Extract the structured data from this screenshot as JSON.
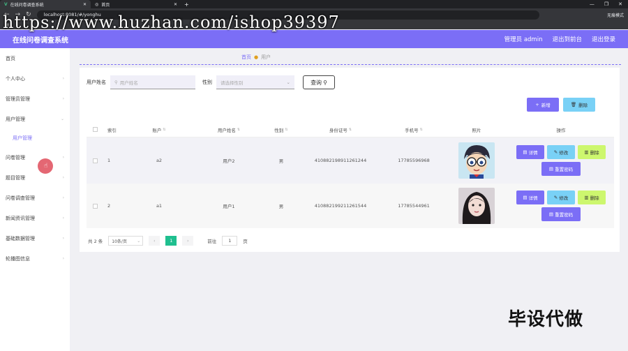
{
  "browser": {
    "tabs": [
      {
        "title": "在线问卷调查系统"
      },
      {
        "title": "首页"
      }
    ],
    "url": "localhost:8081/#/yonghu",
    "incognito_label": "无痕模式"
  },
  "watermark": "https://www.huzhan.com/ishop39397",
  "header": {
    "title": "在线问卷调查系统",
    "admin_label": "管理员 admin",
    "backend_link": "退出到前台",
    "logout_link": "退出登录"
  },
  "sidebar": {
    "items": [
      {
        "label": "首页"
      },
      {
        "label": "个人中心"
      },
      {
        "label": "管理员管理"
      },
      {
        "label": "用户管理"
      },
      {
        "label": "用户管理"
      },
      {
        "label": "问卷管理"
      },
      {
        "label": "题目管理"
      },
      {
        "label": "问卷调查管理"
      },
      {
        "label": "新闻资讯管理"
      },
      {
        "label": "基础数据管理"
      },
      {
        "label": "轮播图信息"
      }
    ]
  },
  "breadcrumb": {
    "home": "首页",
    "current": "用户"
  },
  "search": {
    "name_label": "用户姓名",
    "name_placeholder": "用户姓名",
    "gender_label": "性别",
    "gender_placeholder": "请选择性别",
    "query_button": "查询"
  },
  "actions": {
    "add": "新增",
    "delete": "删除"
  },
  "table": {
    "headers": [
      "索引",
      "账户",
      "用户姓名",
      "性别",
      "身份证号",
      "手机号",
      "照片",
      "操作"
    ],
    "rows": [
      {
        "index": "1",
        "account": "a2",
        "name": "用户2",
        "gender": "男",
        "id_card": "410882198911261244",
        "phone": "17785596968"
      },
      {
        "index": "2",
        "account": "a1",
        "name": "用户1",
        "gender": "男",
        "id_card": "410882199211261544",
        "phone": "17785544961"
      }
    ],
    "row_buttons": {
      "detail": "详情",
      "edit": "修改",
      "remove": "删除",
      "reset": "重置密码"
    }
  },
  "pagination": {
    "total": "共 2 条",
    "page_size": "10条/页",
    "current_page": "1",
    "goto_label": "前往",
    "goto_value": "1",
    "page_unit": "页"
  },
  "stamp": "毕设代做",
  "colors": {
    "primary": "#7b6ef6",
    "info": "#79d1f6",
    "warn": "#cdf76e",
    "active_page": "#1fbf8f"
  }
}
